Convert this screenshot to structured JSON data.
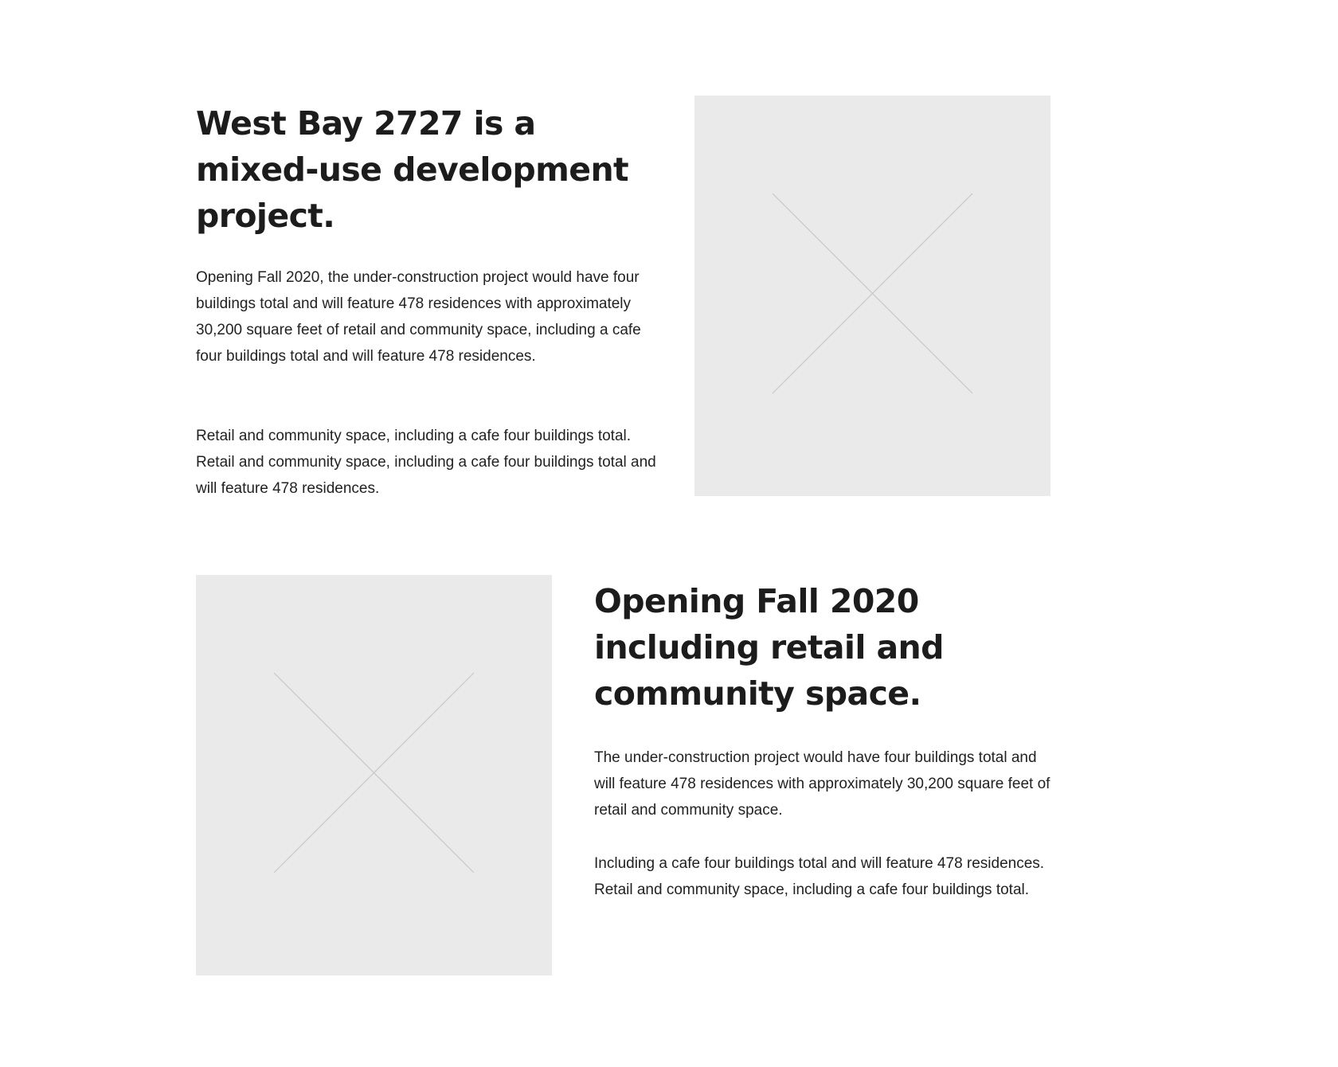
{
  "section_one": {
    "heading": "West Bay 2727 is a mixed-use development project.",
    "paragraph_1": "Opening Fall 2020, the under-construction project would have four buildings total and will feature 478 residences with approximately 30,200 square feet of retail and community space, including a cafe four buildings total and will feature 478 residences.",
    "paragraph_2": "Retail and community space, including a cafe four buildings total. Retail and community space, including a cafe four buildings total and will feature 478 residences.",
    "image_icon": "image-placeholder-icon"
  },
  "section_two": {
    "heading": "Opening Fall 2020 including retail and community space.",
    "paragraph_1": "The under-construction project would have four buildings total and will feature 478 residences with approximately 30,200 square feet of retail and community space.",
    "paragraph_2": "Including a cafe four buildings total and will feature 478 residences. Retail and community space, including a cafe four buildings total.",
    "image_icon": "image-placeholder-icon"
  },
  "colors": {
    "placeholder_fill": "#eaeaea",
    "placeholder_cross": "#c8c8c8",
    "text": "#1f1f1f"
  }
}
